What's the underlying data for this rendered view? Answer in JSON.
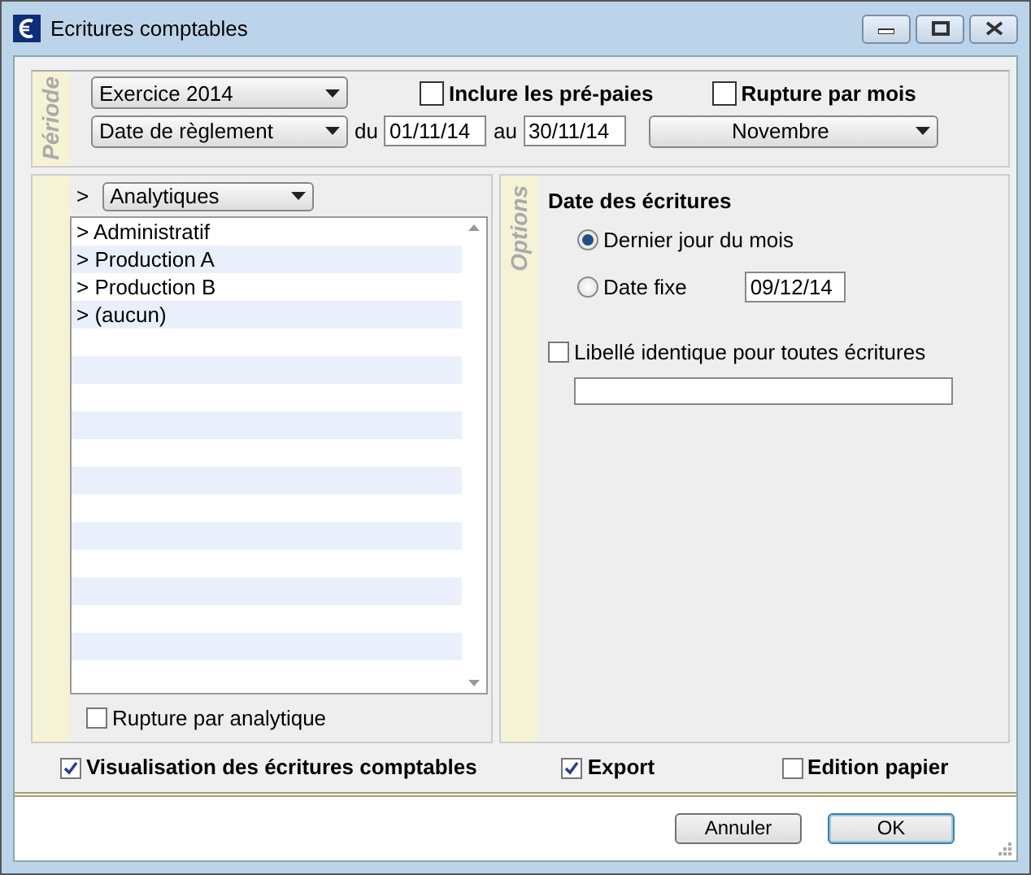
{
  "window": {
    "title": "Ecritures comptables"
  },
  "periode": {
    "label": "Période",
    "exercice": "Exercice 2014",
    "include_prepaid": {
      "label": "Inclure les pré-paies",
      "checked": false
    },
    "rupture_mois": {
      "label": "Rupture par mois",
      "checked": false
    },
    "date_type": "Date de règlement",
    "du_label": "du",
    "from": "01/11/14",
    "au_label": "au",
    "to": "30/11/14",
    "month": "Novembre"
  },
  "analytics": {
    "prefix": ">",
    "selector": "Analytiques",
    "items": [
      {
        "marker": ">",
        "label": "Administratif"
      },
      {
        "marker": ">",
        "label": "Production A"
      },
      {
        "marker": ">",
        "label": "Production B"
      },
      {
        "marker": ">",
        "label": "(aucun)"
      }
    ],
    "rupture": {
      "label": "Rupture par analytique",
      "checked": false
    }
  },
  "options": {
    "label": "Options",
    "heading": "Date des écritures",
    "radios": [
      {
        "label": "Dernier jour du mois",
        "selected": true
      },
      {
        "label": "Date fixe",
        "selected": false
      }
    ],
    "fixed_date": "09/12/14",
    "same_label": {
      "label": "Libellé identique pour toutes écritures",
      "checked": false
    }
  },
  "bottom_checks": [
    {
      "label": "Visualisation des écritures comptables",
      "checked": true
    },
    {
      "label": "Export",
      "checked": true
    },
    {
      "label": "Edition papier",
      "checked": false
    }
  ],
  "buttons": [
    {
      "label": "Annuler",
      "focused": false
    },
    {
      "label": "OK",
      "focused": true
    }
  ]
}
